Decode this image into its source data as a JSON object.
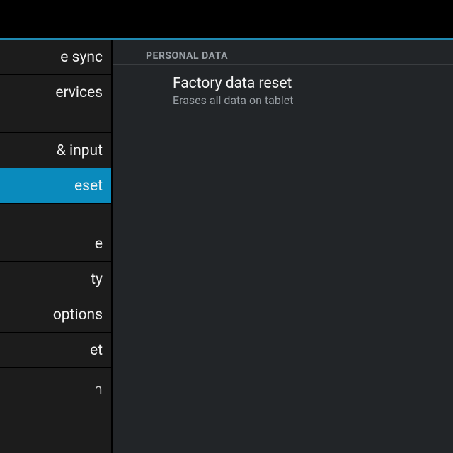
{
  "colors": {
    "accent": "#0a8bbd",
    "divider_accent": "#1f8ab1",
    "bg_sidebar": "#1c1c1c",
    "bg_content": "#222528",
    "text_primary": "#f5f5f5",
    "text_secondary": "#9aa0a6"
  },
  "sidebar": {
    "items": [
      {
        "label": "e sync",
        "selected": false
      },
      {
        "label": "ervices",
        "selected": false
      },
      {
        "gap": true
      },
      {
        "label": "& input",
        "selected": false
      },
      {
        "label": "eset",
        "selected": true
      },
      {
        "gap": true
      },
      {
        "label": "e",
        "selected": false
      },
      {
        "label": "ty",
        "selected": false
      },
      {
        "label": "options",
        "selected": false
      },
      {
        "label": "et",
        "selected": false
      }
    ],
    "loose_item_label": "า"
  },
  "content": {
    "section_header": "PERSONAL DATA",
    "rows": [
      {
        "title": "Factory data reset",
        "subtitle": "Erases all data on tablet"
      }
    ]
  }
}
